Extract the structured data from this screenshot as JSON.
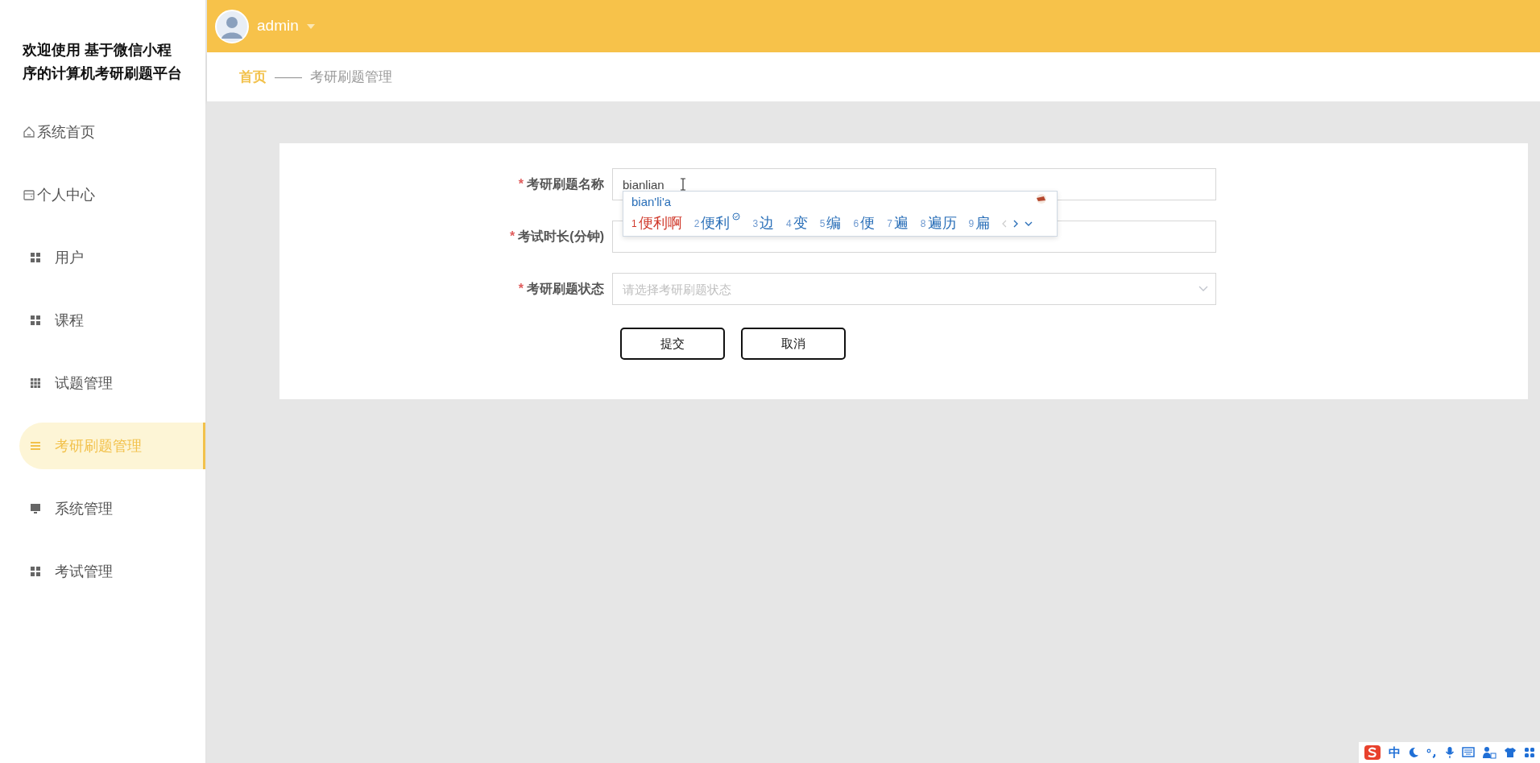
{
  "header": {
    "user": "admin"
  },
  "sidebar": {
    "title": "欢迎使用 基于微信小程序的计算机考研刷题平台",
    "items": [
      {
        "label": "系统首页",
        "kind": "home",
        "selected": false
      },
      {
        "label": "个人中心",
        "kind": "card",
        "selected": false
      },
      {
        "label": "用户",
        "kind": "grid4",
        "selected": false
      },
      {
        "label": "课程",
        "kind": "grid4",
        "selected": false
      },
      {
        "label": "试题管理",
        "kind": "grid9",
        "selected": false
      },
      {
        "label": "考研刷题管理",
        "kind": "list",
        "selected": true
      },
      {
        "label": "系统管理",
        "kind": "monitor",
        "selected": false
      },
      {
        "label": "考试管理",
        "kind": "grid4",
        "selected": false
      }
    ]
  },
  "breadcrumb": {
    "home": "首页",
    "separator": "——",
    "current": "考研刷题管理"
  },
  "form": {
    "fields": [
      {
        "kind": "text",
        "required_mark": "*",
        "label": "考研刷题名称",
        "value": "bianlian"
      },
      {
        "kind": "text",
        "required_mark": "*",
        "label": "考试时长(分钟)"
      },
      {
        "kind": "select",
        "required_mark": "*",
        "label": "考研刷题状态",
        "placeholder": "请选择考研刷题状态"
      }
    ],
    "buttons": [
      "提交",
      "取消"
    ]
  },
  "ime_popup": {
    "composition": "bian'li'a",
    "candidates": [
      {
        "index": "1",
        "text": "便利啊",
        "selected": true
      },
      {
        "index": "2",
        "text": "便利",
        "selected": false
      },
      {
        "index": "3",
        "text": "边",
        "selected": false
      },
      {
        "index": "4",
        "text": "变",
        "selected": false
      },
      {
        "index": "5",
        "text": "编",
        "selected": false
      },
      {
        "index": "6",
        "text": "便",
        "selected": false
      },
      {
        "index": "7",
        "text": "遍",
        "selected": false
      },
      {
        "index": "8",
        "text": "遍历",
        "selected": false
      },
      {
        "index": "9",
        "text": "扁",
        "selected": false
      }
    ]
  },
  "ime_toolbar": {
    "mode": "中"
  }
}
